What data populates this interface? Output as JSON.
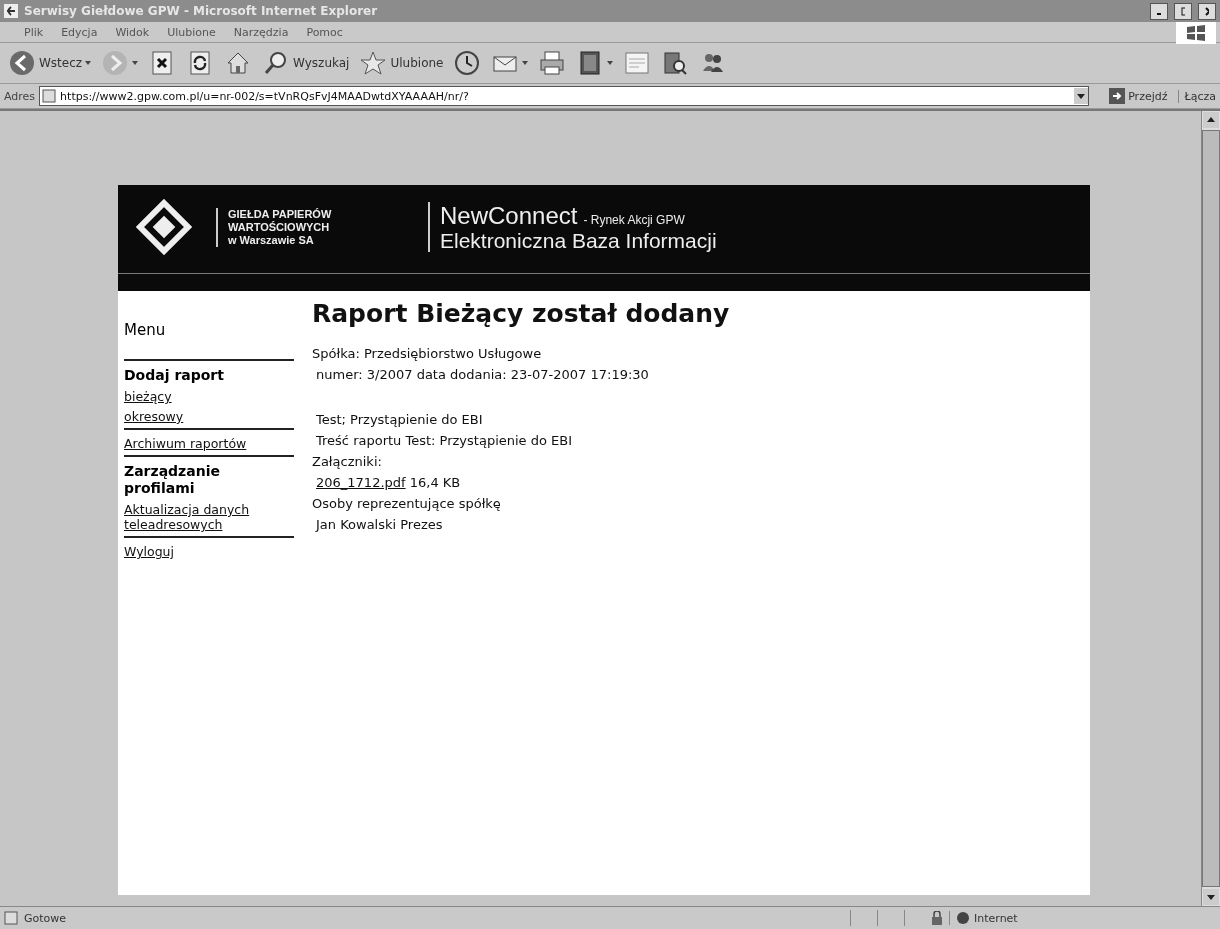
{
  "window": {
    "title": "Serwisy Giełdowe GPW - Microsoft Internet Explorer"
  },
  "menu_bar": [
    "Plik",
    "Edycja",
    "Widok",
    "Ulubione",
    "Narzędzia",
    "Pomoc"
  ],
  "toolbar": [
    {
      "kind": "back",
      "label": "Wstecz",
      "dropdown": true
    },
    {
      "kind": "forward",
      "dropdown": true
    },
    {
      "kind": "stop",
      "dropdown": false
    },
    {
      "kind": "refresh",
      "dropdown": false
    },
    {
      "kind": "home",
      "dropdown": false
    },
    {
      "kind": "search",
      "label": "Wyszukaj",
      "dropdown": false
    },
    {
      "kind": "favorites",
      "label": "Ulubione",
      "dropdown": false
    },
    {
      "kind": "history",
      "dropdown": false
    },
    {
      "kind": "mail",
      "dropdown": true
    },
    {
      "kind": "print",
      "dropdown": false
    },
    {
      "kind": "edit",
      "dropdown": true
    },
    {
      "kind": "discuss",
      "dropdown": false
    },
    {
      "kind": "research",
      "dropdown": false
    },
    {
      "kind": "messenger",
      "dropdown": false
    }
  ],
  "address_bar": {
    "label": "Adres",
    "value": "https://www2.gpw.com.pl/u=nr-002/s=tVnRQsFvJ4MAADwtdXYAAAAH/nr/?",
    "go": "Przejdź",
    "links": "Łącza"
  },
  "header": {
    "logo_lines": [
      "GIEŁDA PAPIERÓW",
      "WARTOŚCIOWYCH",
      "w Warszawie SA"
    ],
    "brand": "NewConnect",
    "brand_suffix": "- Rynek Akcji GPW",
    "subtitle": "Elektroniczna Baza Informacji"
  },
  "sidebar": {
    "title": "Menu",
    "groups": [
      {
        "heading": "Dodaj raport",
        "links": [
          "bieżący",
          "okresowy"
        ]
      },
      {
        "links": [
          "Archiwum raportów"
        ]
      },
      {
        "heading": "Zarządzanie profilami",
        "links": [
          "Aktualizacja danych teleadresowych"
        ]
      },
      {
        "links": [
          "Wyloguj"
        ]
      }
    ]
  },
  "content": {
    "title": "Raport Bieżący został dodany",
    "company": "Spółka: Przedsiębiorstwo Usługowe",
    "number": "numer: 3/2007 data dodania: 23-07-2007 17:19:30",
    "subject": "Test; Przystąpienie do EBI",
    "body": "Treść raportu Test: Przystąpienie do EBI",
    "attachments_label": "Załączniki:",
    "attachments": [
      {
        "file": "206_1712.pdf",
        "size": "16,4 KB"
      }
    ],
    "representatives_label": "Osoby reprezentujące spółkę",
    "representatives": [
      "Jan Kowalski Prezes"
    ]
  },
  "status_bar": {
    "text": "Gotowe",
    "zone": "Internet"
  }
}
